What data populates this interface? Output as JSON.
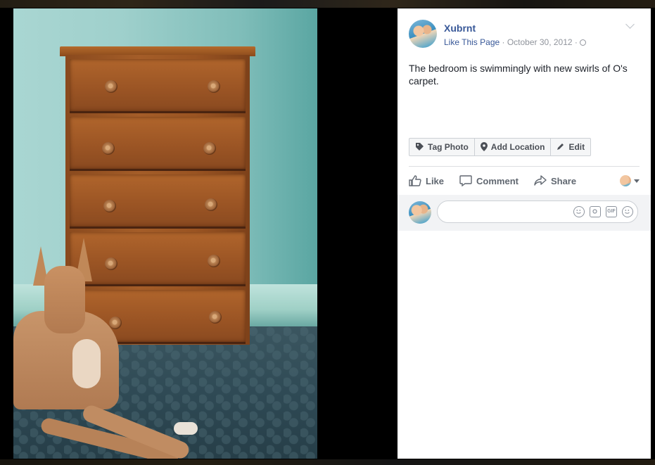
{
  "photo": {
    "alt": ""
  },
  "post": {
    "page_name": "Xubrnt",
    "like_page": "Like This Page",
    "separator": " · ",
    "date": "October 30, 2012",
    "separator2": " · ",
    "caption": "The bedroom is swimmingly with new swirls of O's carpet."
  },
  "photo_actions": {
    "tag_photo": "Tag Photo",
    "add_location": "Add Location",
    "edit": "Edit"
  },
  "actions": {
    "like": "Like",
    "comment": "Comment",
    "share": "Share"
  },
  "comment": {
    "placeholder": "",
    "gif_label": "GIF"
  },
  "colors": {
    "link": "#385898",
    "meta": "#90949c",
    "text": "#1d2129"
  }
}
